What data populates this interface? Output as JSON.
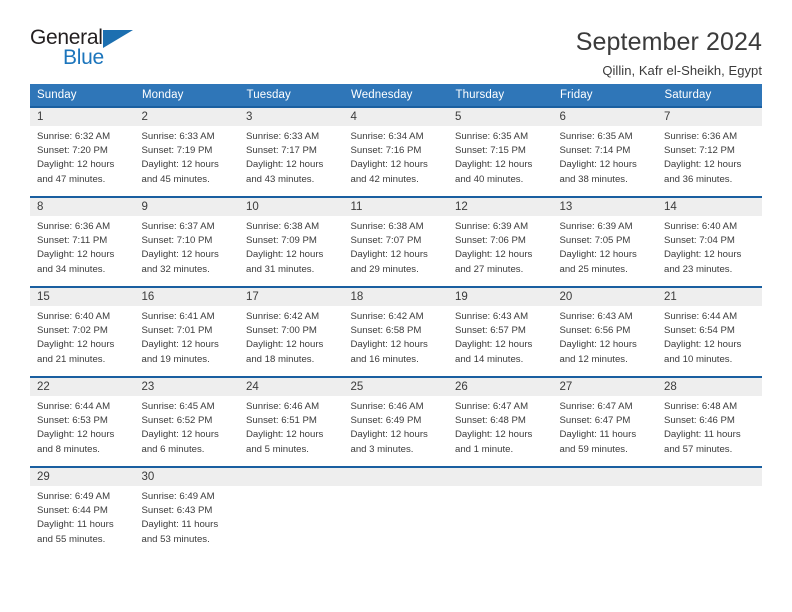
{
  "brand": {
    "name_part1": "General",
    "name_part2": "Blue",
    "accent_color": "#1c75bc",
    "triangle_color": "#1c6fb0",
    "logo_icon": "triangle-icon"
  },
  "header": {
    "title": "September 2024",
    "location": "Qillin, Kafr el-Sheikh, Egypt"
  },
  "theme": {
    "header_row_bg": "#2f76b8",
    "cell_top_border": "#1a5fa0",
    "daynum_bg": "#eeeeee",
    "text_color": "#3b3b3b"
  },
  "weekday_headers": [
    "Sunday",
    "Monday",
    "Tuesday",
    "Wednesday",
    "Thursday",
    "Friday",
    "Saturday"
  ],
  "weeks": [
    [
      {
        "day": "1",
        "sunrise": "Sunrise: 6:32 AM",
        "sunset": "Sunset: 7:20 PM",
        "daylight_line1": "Daylight: 12 hours",
        "daylight_line2": "and 47 minutes."
      },
      {
        "day": "2",
        "sunrise": "Sunrise: 6:33 AM",
        "sunset": "Sunset: 7:19 PM",
        "daylight_line1": "Daylight: 12 hours",
        "daylight_line2": "and 45 minutes."
      },
      {
        "day": "3",
        "sunrise": "Sunrise: 6:33 AM",
        "sunset": "Sunset: 7:17 PM",
        "daylight_line1": "Daylight: 12 hours",
        "daylight_line2": "and 43 minutes."
      },
      {
        "day": "4",
        "sunrise": "Sunrise: 6:34 AM",
        "sunset": "Sunset: 7:16 PM",
        "daylight_line1": "Daylight: 12 hours",
        "daylight_line2": "and 42 minutes."
      },
      {
        "day": "5",
        "sunrise": "Sunrise: 6:35 AM",
        "sunset": "Sunset: 7:15 PM",
        "daylight_line1": "Daylight: 12 hours",
        "daylight_line2": "and 40 minutes."
      },
      {
        "day": "6",
        "sunrise": "Sunrise: 6:35 AM",
        "sunset": "Sunset: 7:14 PM",
        "daylight_line1": "Daylight: 12 hours",
        "daylight_line2": "and 38 minutes."
      },
      {
        "day": "7",
        "sunrise": "Sunrise: 6:36 AM",
        "sunset": "Sunset: 7:12 PM",
        "daylight_line1": "Daylight: 12 hours",
        "daylight_line2": "and 36 minutes."
      }
    ],
    [
      {
        "day": "8",
        "sunrise": "Sunrise: 6:36 AM",
        "sunset": "Sunset: 7:11 PM",
        "daylight_line1": "Daylight: 12 hours",
        "daylight_line2": "and 34 minutes."
      },
      {
        "day": "9",
        "sunrise": "Sunrise: 6:37 AM",
        "sunset": "Sunset: 7:10 PM",
        "daylight_line1": "Daylight: 12 hours",
        "daylight_line2": "and 32 minutes."
      },
      {
        "day": "10",
        "sunrise": "Sunrise: 6:38 AM",
        "sunset": "Sunset: 7:09 PM",
        "daylight_line1": "Daylight: 12 hours",
        "daylight_line2": "and 31 minutes."
      },
      {
        "day": "11",
        "sunrise": "Sunrise: 6:38 AM",
        "sunset": "Sunset: 7:07 PM",
        "daylight_line1": "Daylight: 12 hours",
        "daylight_line2": "and 29 minutes."
      },
      {
        "day": "12",
        "sunrise": "Sunrise: 6:39 AM",
        "sunset": "Sunset: 7:06 PM",
        "daylight_line1": "Daylight: 12 hours",
        "daylight_line2": "and 27 minutes."
      },
      {
        "day": "13",
        "sunrise": "Sunrise: 6:39 AM",
        "sunset": "Sunset: 7:05 PM",
        "daylight_line1": "Daylight: 12 hours",
        "daylight_line2": "and 25 minutes."
      },
      {
        "day": "14",
        "sunrise": "Sunrise: 6:40 AM",
        "sunset": "Sunset: 7:04 PM",
        "daylight_line1": "Daylight: 12 hours",
        "daylight_line2": "and 23 minutes."
      }
    ],
    [
      {
        "day": "15",
        "sunrise": "Sunrise: 6:40 AM",
        "sunset": "Sunset: 7:02 PM",
        "daylight_line1": "Daylight: 12 hours",
        "daylight_line2": "and 21 minutes."
      },
      {
        "day": "16",
        "sunrise": "Sunrise: 6:41 AM",
        "sunset": "Sunset: 7:01 PM",
        "daylight_line1": "Daylight: 12 hours",
        "daylight_line2": "and 19 minutes."
      },
      {
        "day": "17",
        "sunrise": "Sunrise: 6:42 AM",
        "sunset": "Sunset: 7:00 PM",
        "daylight_line1": "Daylight: 12 hours",
        "daylight_line2": "and 18 minutes."
      },
      {
        "day": "18",
        "sunrise": "Sunrise: 6:42 AM",
        "sunset": "Sunset: 6:58 PM",
        "daylight_line1": "Daylight: 12 hours",
        "daylight_line2": "and 16 minutes."
      },
      {
        "day": "19",
        "sunrise": "Sunrise: 6:43 AM",
        "sunset": "Sunset: 6:57 PM",
        "daylight_line1": "Daylight: 12 hours",
        "daylight_line2": "and 14 minutes."
      },
      {
        "day": "20",
        "sunrise": "Sunrise: 6:43 AM",
        "sunset": "Sunset: 6:56 PM",
        "daylight_line1": "Daylight: 12 hours",
        "daylight_line2": "and 12 minutes."
      },
      {
        "day": "21",
        "sunrise": "Sunrise: 6:44 AM",
        "sunset": "Sunset: 6:54 PM",
        "daylight_line1": "Daylight: 12 hours",
        "daylight_line2": "and 10 minutes."
      }
    ],
    [
      {
        "day": "22",
        "sunrise": "Sunrise: 6:44 AM",
        "sunset": "Sunset: 6:53 PM",
        "daylight_line1": "Daylight: 12 hours",
        "daylight_line2": "and 8 minutes."
      },
      {
        "day": "23",
        "sunrise": "Sunrise: 6:45 AM",
        "sunset": "Sunset: 6:52 PM",
        "daylight_line1": "Daylight: 12 hours",
        "daylight_line2": "and 6 minutes."
      },
      {
        "day": "24",
        "sunrise": "Sunrise: 6:46 AM",
        "sunset": "Sunset: 6:51 PM",
        "daylight_line1": "Daylight: 12 hours",
        "daylight_line2": "and 5 minutes."
      },
      {
        "day": "25",
        "sunrise": "Sunrise: 6:46 AM",
        "sunset": "Sunset: 6:49 PM",
        "daylight_line1": "Daylight: 12 hours",
        "daylight_line2": "and 3 minutes."
      },
      {
        "day": "26",
        "sunrise": "Sunrise: 6:47 AM",
        "sunset": "Sunset: 6:48 PM",
        "daylight_line1": "Daylight: 12 hours",
        "daylight_line2": "and 1 minute."
      },
      {
        "day": "27",
        "sunrise": "Sunrise: 6:47 AM",
        "sunset": "Sunset: 6:47 PM",
        "daylight_line1": "Daylight: 11 hours",
        "daylight_line2": "and 59 minutes."
      },
      {
        "day": "28",
        "sunrise": "Sunrise: 6:48 AM",
        "sunset": "Sunset: 6:46 PM",
        "daylight_line1": "Daylight: 11 hours",
        "daylight_line2": "and 57 minutes."
      }
    ],
    [
      {
        "day": "29",
        "sunrise": "Sunrise: 6:49 AM",
        "sunset": "Sunset: 6:44 PM",
        "daylight_line1": "Daylight: 11 hours",
        "daylight_line2": "and 55 minutes."
      },
      {
        "day": "30",
        "sunrise": "Sunrise: 6:49 AM",
        "sunset": "Sunset: 6:43 PM",
        "daylight_line1": "Daylight: 11 hours",
        "daylight_line2": "and 53 minutes."
      },
      {
        "day": "",
        "sunrise": "",
        "sunset": "",
        "daylight_line1": "",
        "daylight_line2": ""
      },
      {
        "day": "",
        "sunrise": "",
        "sunset": "",
        "daylight_line1": "",
        "daylight_line2": ""
      },
      {
        "day": "",
        "sunrise": "",
        "sunset": "",
        "daylight_line1": "",
        "daylight_line2": ""
      },
      {
        "day": "",
        "sunrise": "",
        "sunset": "",
        "daylight_line1": "",
        "daylight_line2": ""
      },
      {
        "day": "",
        "sunrise": "",
        "sunset": "",
        "daylight_line1": "",
        "daylight_line2": ""
      }
    ]
  ]
}
